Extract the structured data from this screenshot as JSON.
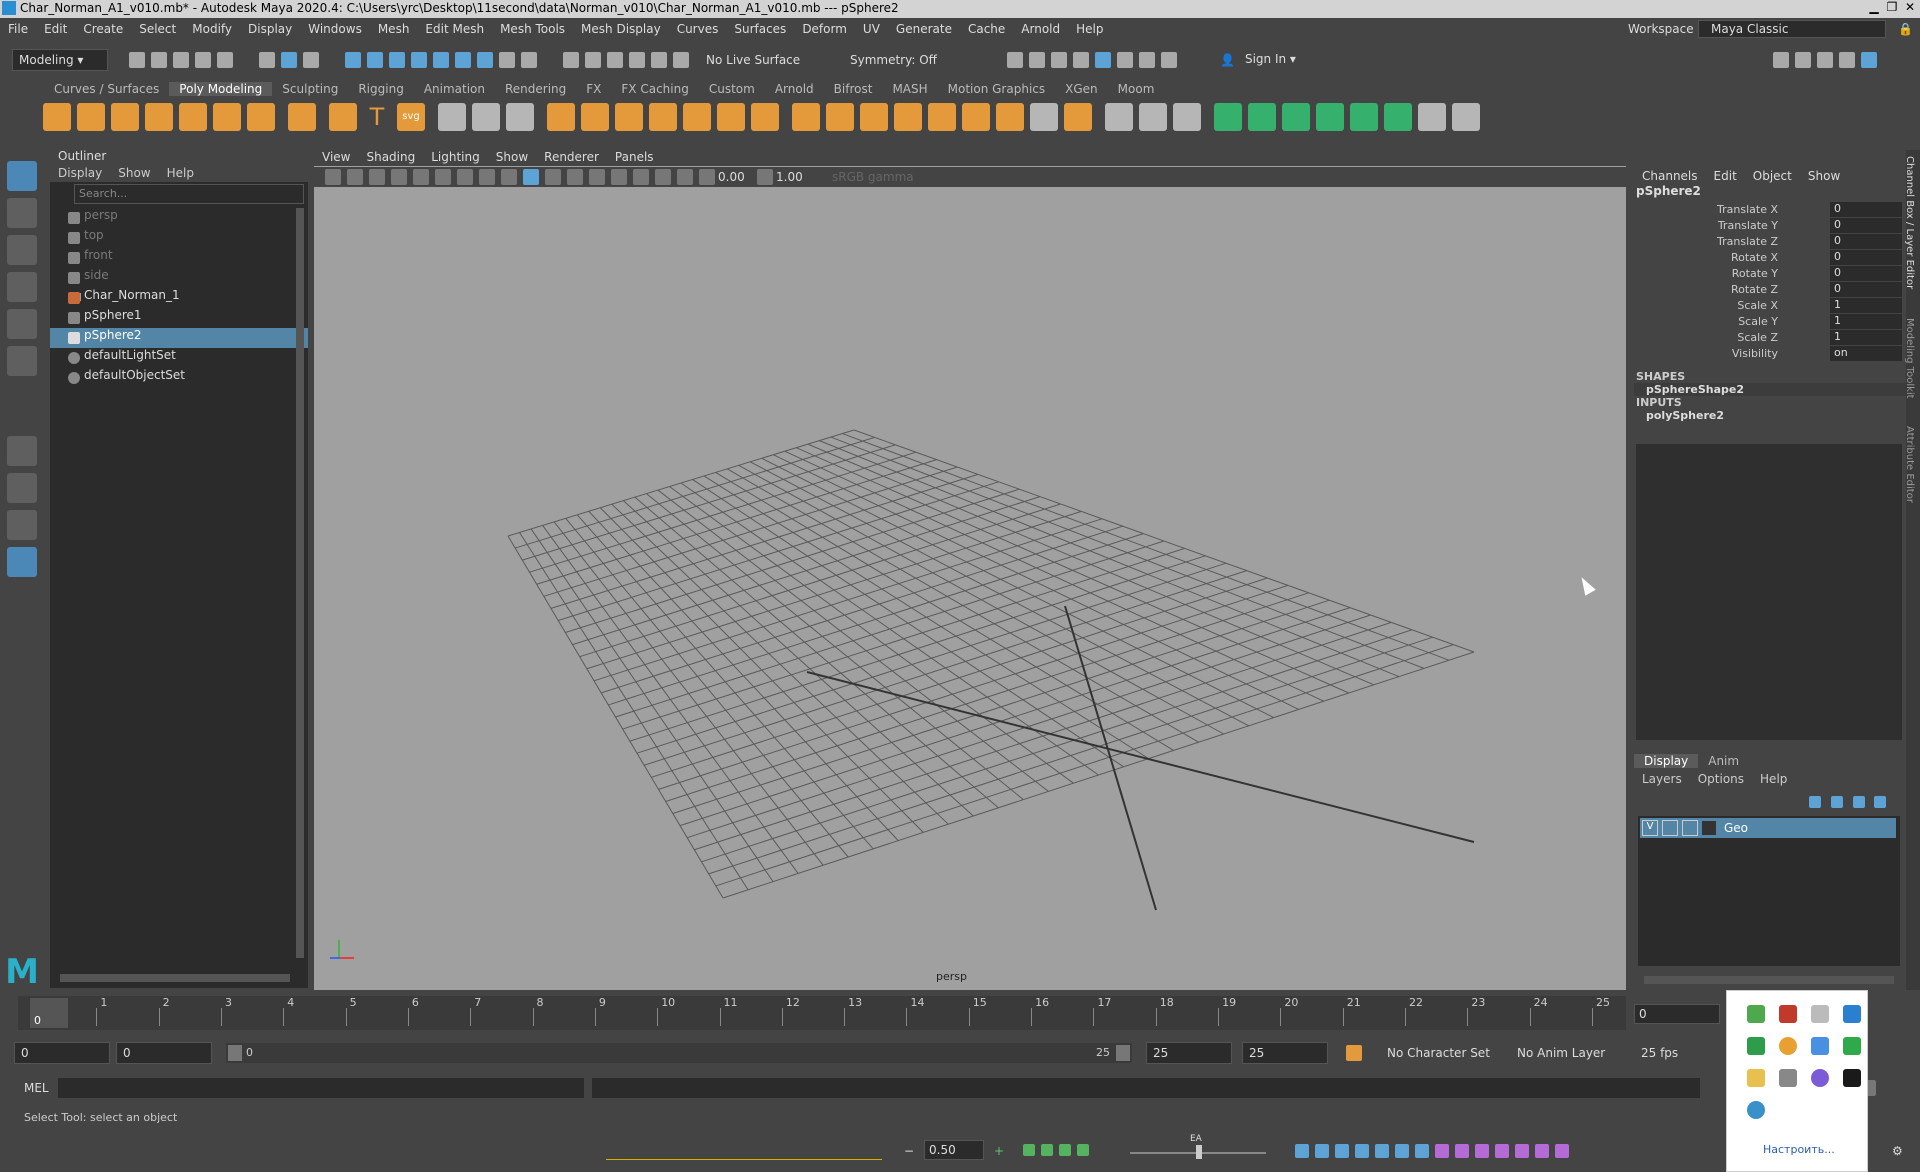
{
  "title": "Char_Norman_A1_v010.mb* - Autodesk Maya 2020.4: C:\\Users\\yrc\\Desktop\\11second\\data\\Norman_v010\\Char_Norman_A1_v010.mb  ---  pSphere2",
  "menus": [
    "File",
    "Edit",
    "Create",
    "Select",
    "Modify",
    "Display",
    "Windows",
    "Mesh",
    "Edit Mesh",
    "Mesh Tools",
    "Mesh Display",
    "Curves",
    "Surfaces",
    "Deform",
    "UV",
    "Generate",
    "Cache",
    "Arnold",
    "Help"
  ],
  "workspace": {
    "label": "Workspace :",
    "value": "Maya Classic"
  },
  "toolbar": {
    "mode": "Modeling",
    "live_surface": "No Live Surface",
    "symmetry": "Symmetry: Off",
    "sign_in": "Sign In"
  },
  "shelf_tabs": [
    "Curves / Surfaces",
    "Poly Modeling",
    "Sculpting",
    "Rigging",
    "Animation",
    "Rendering",
    "FX",
    "FX Caching",
    "Custom",
    "Arnold",
    "Bifrost",
    "MASH",
    "Motion Graphics",
    "XGen",
    "Moom"
  ],
  "shelf_active": "Poly Modeling",
  "shelf_svg": "svg",
  "shelf_text": "T",
  "outliner": {
    "title": "Outliner",
    "menu": [
      "Display",
      "Show",
      "Help"
    ],
    "search": "Search...",
    "items": [
      {
        "label": "persp",
        "dim": true
      },
      {
        "label": "top",
        "dim": true
      },
      {
        "label": "front",
        "dim": true
      },
      {
        "label": "side",
        "dim": true
      },
      {
        "label": "Char_Norman_1"
      },
      {
        "label": "pSphere1"
      },
      {
        "label": "pSphere2",
        "selected": true
      },
      {
        "label": "defaultLightSet"
      },
      {
        "label": "defaultObjectSet"
      }
    ]
  },
  "viewport": {
    "menu": [
      "View",
      "Shading",
      "Lighting",
      "Show",
      "Renderer",
      "Panels"
    ],
    "exposure": "0.00",
    "gamma": "1.00",
    "colorspace": "sRGB gamma",
    "camera": "persp"
  },
  "channel_box": {
    "tabs": [
      "Channels",
      "Edit",
      "Object",
      "Show"
    ],
    "object": "pSphere2",
    "attrs": [
      {
        "name": "Translate X",
        "value": "0"
      },
      {
        "name": "Translate Y",
        "value": "0"
      },
      {
        "name": "Translate Z",
        "value": "0"
      },
      {
        "name": "Rotate X",
        "value": "0"
      },
      {
        "name": "Rotate Y",
        "value": "0"
      },
      {
        "name": "Rotate Z",
        "value": "0"
      },
      {
        "name": "Scale X",
        "value": "1"
      },
      {
        "name": "Scale Y",
        "value": "1"
      },
      {
        "name": "Scale Z",
        "value": "1"
      },
      {
        "name": "Visibility",
        "value": "on"
      }
    ],
    "shapes_label": "SHAPES",
    "shape": "pSphereShape2",
    "inputs_label": "INPUTS",
    "input": "polySphere2"
  },
  "side_tabs": [
    "Channel Box / Layer Editor",
    "Modeling Toolkit",
    "Attribute Editor"
  ],
  "layers": {
    "tabs": [
      "Display",
      "Anim"
    ],
    "menu": [
      "Layers",
      "Options",
      "Help"
    ],
    "layer": {
      "v": "V",
      "name": "Geo"
    }
  },
  "timeline": {
    "ticks": [
      "0",
      "1",
      "2",
      "3",
      "4",
      "5",
      "6",
      "7",
      "8",
      "9",
      "10",
      "11",
      "12",
      "13",
      "14",
      "15",
      "16",
      "17",
      "18",
      "19",
      "20",
      "21",
      "22",
      "23",
      "24",
      "25"
    ],
    "current": "0",
    "current_frame": "0"
  },
  "range": {
    "start": "0",
    "inner_start": "0",
    "slider_start": "0",
    "slider_end": "25",
    "end": "25",
    "outer_end": "25",
    "character_set": "No Character Set",
    "anim_layer": "No Anim Layer",
    "fps": "25 fps"
  },
  "cmd": {
    "label": "MEL"
  },
  "help_line": "Select Tool: select an object",
  "bottom": {
    "value": "0.50",
    "ea": "EA"
  },
  "tray": {
    "customize": "Настроить..."
  }
}
